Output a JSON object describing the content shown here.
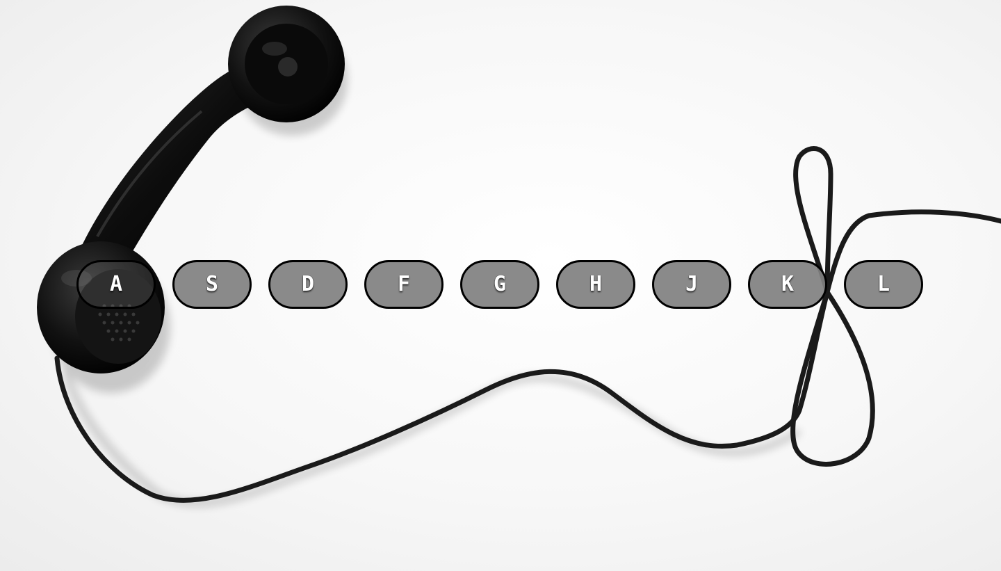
{
  "keyboard": {
    "keys": [
      {
        "label": "A"
      },
      {
        "label": "S"
      },
      {
        "label": "D"
      },
      {
        "label": "F"
      },
      {
        "label": "G"
      },
      {
        "label": "H"
      },
      {
        "label": "J"
      },
      {
        "label": "K"
      },
      {
        "label": "L"
      }
    ]
  },
  "colors": {
    "key_fill": "#808080",
    "key_border": "#000000",
    "key_text": "#ffffff",
    "background": "#f7f7f7"
  },
  "icons": {
    "background_image": "telephone-handset-with-cord-icon"
  }
}
